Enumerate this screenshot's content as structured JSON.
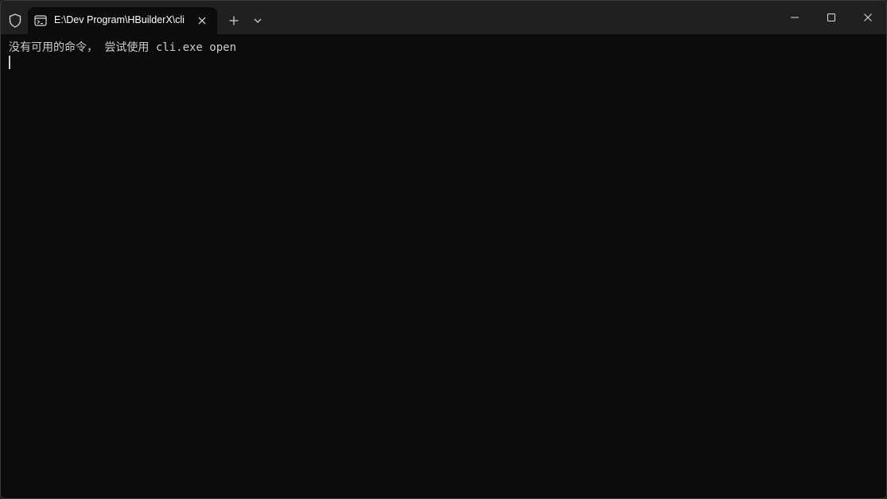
{
  "window": {
    "tab_title": "E:\\Dev Program\\HBuilderX\\cli",
    "tab_icon": "terminal-icon",
    "shield_icon": "shield-icon"
  },
  "terminal": {
    "lines": [
      "没有可用的命令， 尝试使用 cli.exe open"
    ]
  },
  "colors": {
    "titlebar_bg": "#202020",
    "terminal_bg": "#0c0c0c",
    "text": "#cccccc"
  }
}
